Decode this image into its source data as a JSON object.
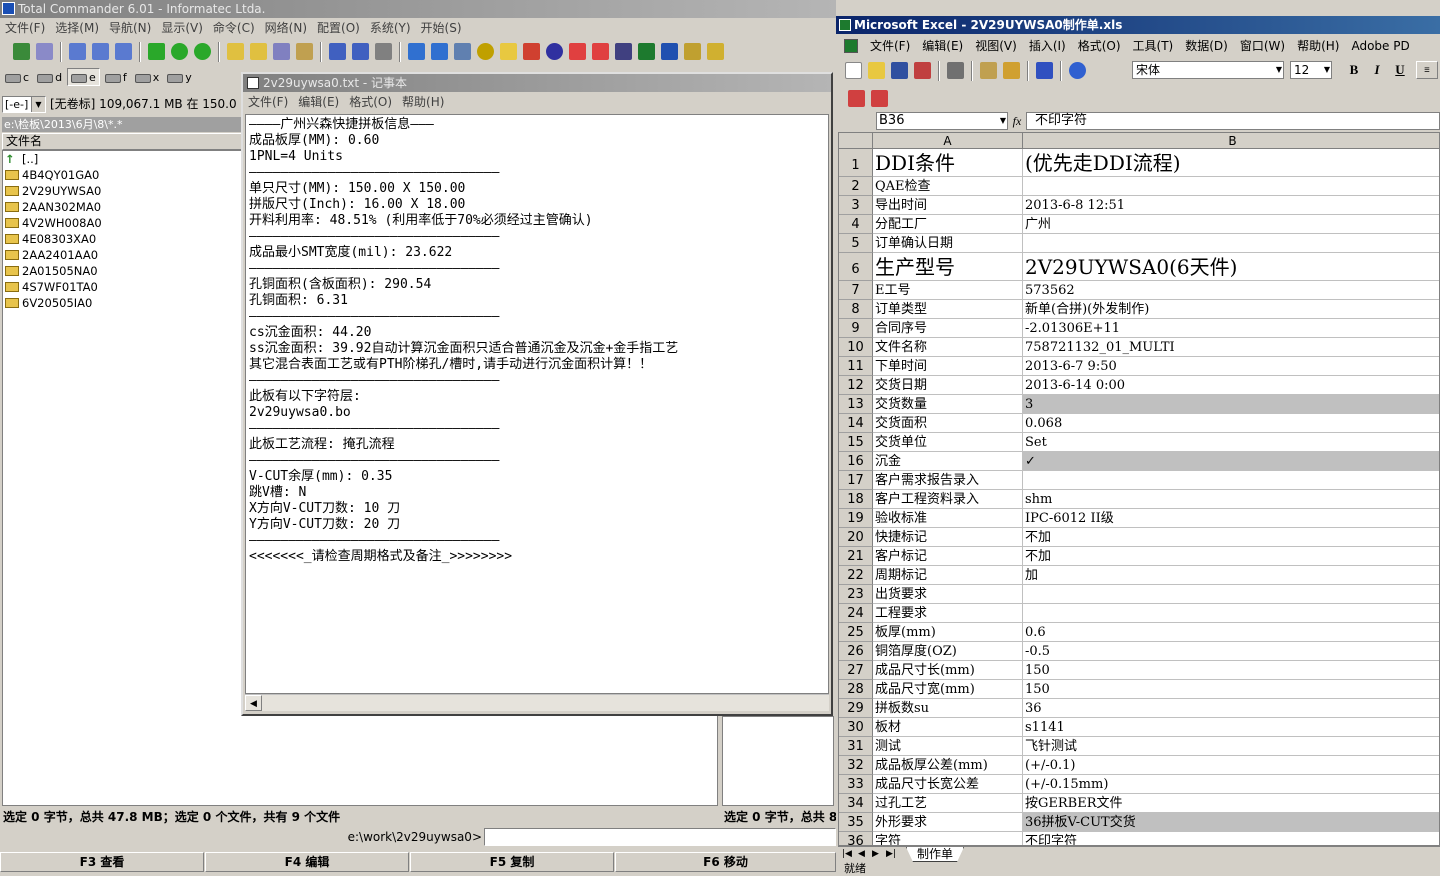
{
  "tc": {
    "title": "Total Commander 6.01 - Informatec Ltda.",
    "menu": [
      "文件(F)",
      "选择(M)",
      "导航(N)",
      "显示(V)",
      "命令(C)",
      "网络(N)",
      "配置(O)",
      "系统(Y)",
      "开始(S)"
    ],
    "drives": [
      "c",
      "d",
      "e",
      "f",
      "x",
      "y"
    ],
    "drive_select": "[-e-]",
    "drive_info": "[无卷标]  109,067.1 MB 在 150.0",
    "path": "e:\\检板\\2013\\6月\\8\\*.*",
    "header_name": "文件名",
    "files": [
      "[..]",
      "4B4QY01GA0",
      "2V29UYWSA0",
      "2AAN302MA0",
      "4V2WH008A0",
      "4E08303XA0",
      "2AA2401AA0",
      "2A01505NA0",
      "4S7WF01TA0",
      "6V20505IA0"
    ],
    "status_left": "选定 0 字节，总共 47.8 MB；选定 0 个文件，共有 9 个文件",
    "status_right": "选定 0 字节，总共 8",
    "cmd_path": "e:\\work\\2v29uywsa0>",
    "fkeys": [
      "F3 查看",
      "F4 编辑",
      "F5 复制",
      "F6 移动"
    ]
  },
  "notepad": {
    "title": "2v29uywsa0.txt - 记事本",
    "menu": [
      "文件(F)",
      "编辑(E)",
      "格式(O)",
      "帮助(H)"
    ],
    "lines": [
      {
        "text": "————广州兴森快捷拼板信息———"
      },
      {
        "text": "成品板厚(MM): 0.60"
      },
      {
        "text": "1PNL=4 Units"
      },
      {
        "text": "————————————————————————————————"
      },
      {
        "text": "单只尺寸(MM): 150.00 X 150.00"
      },
      {
        "text": "拼版尺寸(Inch): 16.00 X 18.00"
      },
      {
        "text": "开料利用率: 48.51% (利用率低于70%必须经过主管确认)"
      },
      {
        "text": "————————————————————————————————"
      },
      {
        "text": "成品最小SMT宽度(mil): 23.622"
      },
      {
        "text": "————————————————————————————————"
      },
      {
        "text": "孔铜面积(含板面积): 290.54"
      },
      {
        "text": "孔铜面积: 6.31"
      },
      {
        "text": "————————————————————————————————"
      },
      {
        "text": "cs沉金面积: 44.20"
      },
      {
        "text": "ss沉金面积: 39.92自动计算沉金面积只适合普通沉金及沉金+金手指工艺"
      },
      {
        "text": "其它混合表面工艺或有PTH阶梯孔/槽时,请手动进行沉金面积计算！！"
      },
      {
        "text": "————————————————————————————————"
      },
      {
        "text": "此板有以下字符层:"
      },
      {
        "text": "2v29uywsa0.bo"
      },
      {
        "text": "————————————————————————————————"
      },
      {
        "text": "此板工艺流程: 掩孔流程"
      },
      {
        "text": "————————————————————————————————"
      },
      {
        "text": "V-CUT余厚(mm): 0.35"
      },
      {
        "text": "跳V槽: N"
      },
      {
        "text": "X方向V-CUT刀数: 10 刀"
      },
      {
        "text": "Y方向V-CUT刀数: 20 刀"
      },
      {
        "text": "————————————————————————————————"
      },
      {
        "text": "<<<<<<<_请检查周期格式及备注_>>>>>>>>"
      }
    ]
  },
  "excel": {
    "title": "Microsoft Excel - 2V29UYWSA0制作单.xls",
    "menu": [
      "文件(F)",
      "编辑(E)",
      "视图(V)",
      "插入(I)",
      "格式(O)",
      "工具(T)",
      "数据(D)",
      "窗口(W)",
      "帮助(H)",
      "Adobe PD"
    ],
    "font_name": "宋体",
    "font_size": "12",
    "bold": "B",
    "italic": "I",
    "underline": "U",
    "name_box": "B36",
    "fx": "fx",
    "formula": "不印字符",
    "col_a": "A",
    "col_b": "B",
    "sheet_tab": "制作单",
    "status": "就绪",
    "rows": [
      {
        "n": "1",
        "a": "DDI条件",
        "b": "(优先走DDI流程)"
      },
      {
        "n": "2",
        "a": "QAE检查",
        "b": ""
      },
      {
        "n": "3",
        "a": "导出时间",
        "b": "2013-6-8 12:51"
      },
      {
        "n": "4",
        "a": "分配工厂",
        "b": "广州"
      },
      {
        "n": "5",
        "a": "订单确认日期",
        "b": ""
      },
      {
        "n": "6",
        "a": "生产型号",
        "b": "2V29UYWSA0(6天件)"
      },
      {
        "n": "7",
        "a": "E工号",
        "b": "573562"
      },
      {
        "n": "8",
        "a": "订单类型",
        "b": "新单(合拼)(外发制作)"
      },
      {
        "n": "9",
        "a": "合同序号",
        "b": "-2.01306E+11"
      },
      {
        "n": "10",
        "a": "文件名称",
        "b": "758721132_01_MULTI"
      },
      {
        "n": "11",
        "a": "下单时间",
        "b": "2013-6-7 9:50"
      },
      {
        "n": "12",
        "a": "交货日期",
        "b": "2013-6-14 0:00"
      },
      {
        "n": "13",
        "a": "交货数量",
        "b": "3"
      },
      {
        "n": "14",
        "a": "交货面积",
        "b": "0.068"
      },
      {
        "n": "15",
        "a": "交货单位",
        "b": "Set"
      },
      {
        "n": "16",
        "a": "沉金",
        "b": "✓"
      },
      {
        "n": "17",
        "a": "客户需求报告录入",
        "b": ""
      },
      {
        "n": "18",
        "a": "客户工程资料录入",
        "b": "shm"
      },
      {
        "n": "19",
        "a": "验收标准",
        "b": "IPC-6012 II级"
      },
      {
        "n": "20",
        "a": "快捷标记",
        "b": "不加"
      },
      {
        "n": "21",
        "a": "客户标记",
        "b": "不加"
      },
      {
        "n": "22",
        "a": "周期标记",
        "b": "加"
      },
      {
        "n": "23",
        "a": "出货要求",
        "b": ""
      },
      {
        "n": "24",
        "a": "工程要求",
        "b": ""
      },
      {
        "n": "25",
        "a": "板厚(mm)",
        "b": "0.6"
      },
      {
        "n": "26",
        "a": "铜箔厚度(OZ)",
        "b": "-0.5"
      },
      {
        "n": "27",
        "a": "成品尺寸长(mm)",
        "b": "150"
      },
      {
        "n": "28",
        "a": "成品尺寸宽(mm)",
        "b": "150"
      },
      {
        "n": "29",
        "a": "拼板数su",
        "b": "36"
      },
      {
        "n": "30",
        "a": "板材",
        "b": "s1141"
      },
      {
        "n": "31",
        "a": "测试",
        "b": "飞针测试"
      },
      {
        "n": "32",
        "a": "成品板厚公差(mm)",
        "b": "(+/-0.1)"
      },
      {
        "n": "33",
        "a": "成品尺寸长宽公差",
        "b": "(+/-0.15mm)"
      },
      {
        "n": "34",
        "a": "过孔工艺",
        "b": "按GERBER文件"
      },
      {
        "n": "35",
        "a": "外形要求",
        "b": "36拼板V-CUT交货"
      },
      {
        "n": "36",
        "a": "字符",
        "b": "不印字符"
      }
    ]
  }
}
